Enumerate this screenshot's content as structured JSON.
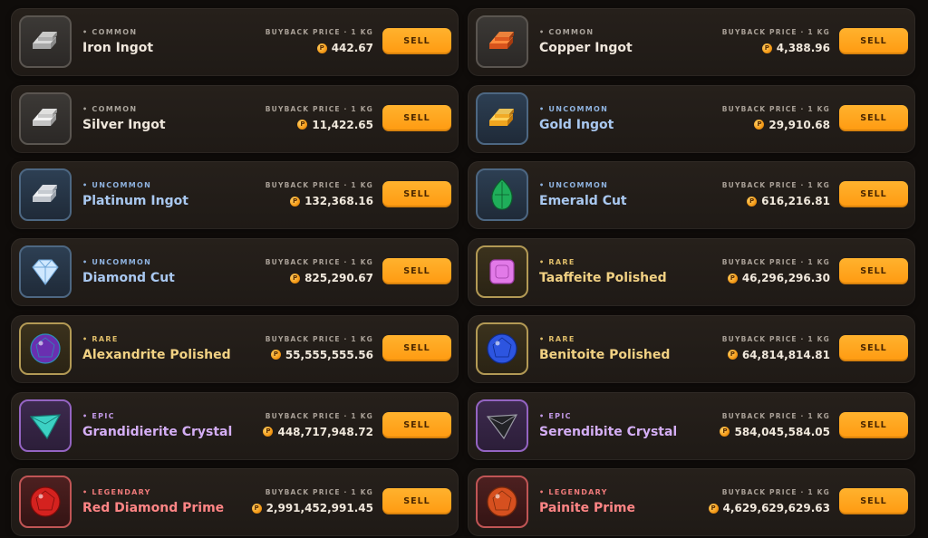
{
  "price_label": "BUYBACK PRICE · 1 KG",
  "coin_symbol": "P",
  "sell_label": "SELL",
  "items": [
    {
      "name": "Iron Ingot",
      "rarity": "COMMON",
      "tier": "common",
      "price": "442.67",
      "icon": "iron-ingot-icon"
    },
    {
      "name": "Copper Ingot",
      "rarity": "COMMON",
      "tier": "common",
      "price": "4,388.96",
      "icon": "copper-ingot-icon"
    },
    {
      "name": "Silver Ingot",
      "rarity": "COMMON",
      "tier": "common",
      "price": "11,422.65",
      "icon": "silver-ingot-icon"
    },
    {
      "name": "Gold Ingot",
      "rarity": "UNCOMMON",
      "tier": "uncommon",
      "price": "29,910.68",
      "icon": "gold-ingot-icon"
    },
    {
      "name": "Platinum Ingot",
      "rarity": "UNCOMMON",
      "tier": "uncommon",
      "price": "132,368.16",
      "icon": "platinum-ingot-icon"
    },
    {
      "name": "Emerald Cut",
      "rarity": "UNCOMMON",
      "tier": "uncommon",
      "price": "616,216.81",
      "icon": "emerald-gem-icon"
    },
    {
      "name": "Diamond Cut",
      "rarity": "UNCOMMON",
      "tier": "uncommon",
      "price": "825,290.67",
      "icon": "diamond-gem-icon"
    },
    {
      "name": "Taaffeite Polished",
      "rarity": "RARE",
      "tier": "rare",
      "price": "46,296,296.30",
      "icon": "taaffeite-gem-icon"
    },
    {
      "name": "Alexandrite Polished",
      "rarity": "RARE",
      "tier": "rare",
      "price": "55,555,555.56",
      "icon": "alexandrite-gem-icon"
    },
    {
      "name": "Benitoite Polished",
      "rarity": "RARE",
      "tier": "rare",
      "price": "64,814,814.81",
      "icon": "benitoite-gem-icon"
    },
    {
      "name": "Grandidierite Crystal",
      "rarity": "EPIC",
      "tier": "epic",
      "price": "448,717,948.72",
      "icon": "grandidierite-crystal-icon"
    },
    {
      "name": "Serendibite Crystal",
      "rarity": "EPIC",
      "tier": "epic",
      "price": "584,045,584.05",
      "icon": "serendibite-crystal-icon"
    },
    {
      "name": "Red Diamond Prime",
      "rarity": "LEGENDARY",
      "tier": "legendary",
      "price": "2,991,452,991.45",
      "icon": "red-diamond-gem-icon"
    },
    {
      "name": "Painite Prime",
      "rarity": "LEGENDARY",
      "tier": "legendary",
      "price": "4,629,629,629.63",
      "icon": "painite-gem-icon"
    }
  ],
  "colors": {
    "accent_button": "#ff9f1a",
    "common": "#a9a39b",
    "uncommon": "#8fb3e0",
    "rare": "#e0be6a",
    "epic": "#c39ae8",
    "legendary": "#ef7a7a"
  }
}
